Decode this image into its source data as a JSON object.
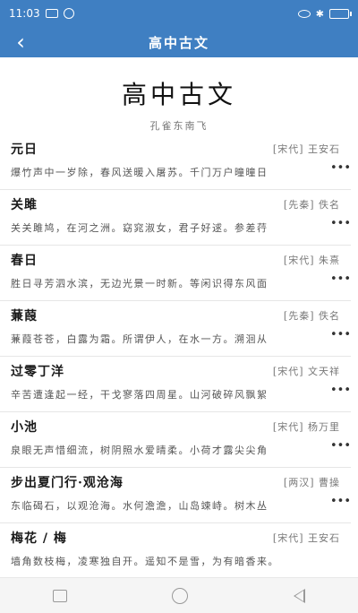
{
  "status": {
    "time": "11:03",
    "left_icons": [
      "message-icon",
      "signal-icon"
    ],
    "right_icons": [
      "eye-icon",
      "bluetooth-icon",
      "battery-icon"
    ]
  },
  "nav": {
    "back_icon": "chevron-left-icon",
    "title": "高中古文"
  },
  "header": {
    "title": "高中古文",
    "subtitle": "孔雀东南飞"
  },
  "poems": [
    {
      "title": "元日",
      "meta": "[宋代] 王安石",
      "line": "爆竹声中一岁除，春风送暖入屠苏。千门万户曈曈日"
    },
    {
      "title": "关雎",
      "meta": "[先秦] 佚名",
      "line": "关关雎鸠，在河之洲。窈窕淑女，君子好逑。参差荇"
    },
    {
      "title": "春日",
      "meta": "[宋代] 朱熹",
      "line": "胜日寻芳泗水滨，无边光景一时新。等闲识得东风面"
    },
    {
      "title": "蒹葭",
      "meta": "[先秦] 佚名",
      "line": "蒹葭苍苍，白露为霜。所谓伊人，在水一方。溯洄从"
    },
    {
      "title": "过零丁洋",
      "meta": "[宋代] 文天祥",
      "line": "辛苦遭逢起一经，干戈寥落四周星。山河破碎风飘絮"
    },
    {
      "title": "小池",
      "meta": "[宋代] 杨万里",
      "line": "泉眼无声惜细流，树阴照水爱晴柔。小荷才露尖尖角"
    },
    {
      "title": "步出夏门行·观沧海",
      "meta": "[两汉] 曹操",
      "line": "东临碣石，以观沧海。水何澹澹，山岛竦峙。树木丛"
    },
    {
      "title": "梅花 / 梅",
      "meta": "[宋代] 王安石",
      "line": "墙角数枝梅，凌寒独自开。遥知不是雪，为有暗香来。"
    }
  ],
  "more_glyph": "•••",
  "bottom_nav": [
    "recent-apps-icon",
    "home-icon",
    "back-icon"
  ]
}
